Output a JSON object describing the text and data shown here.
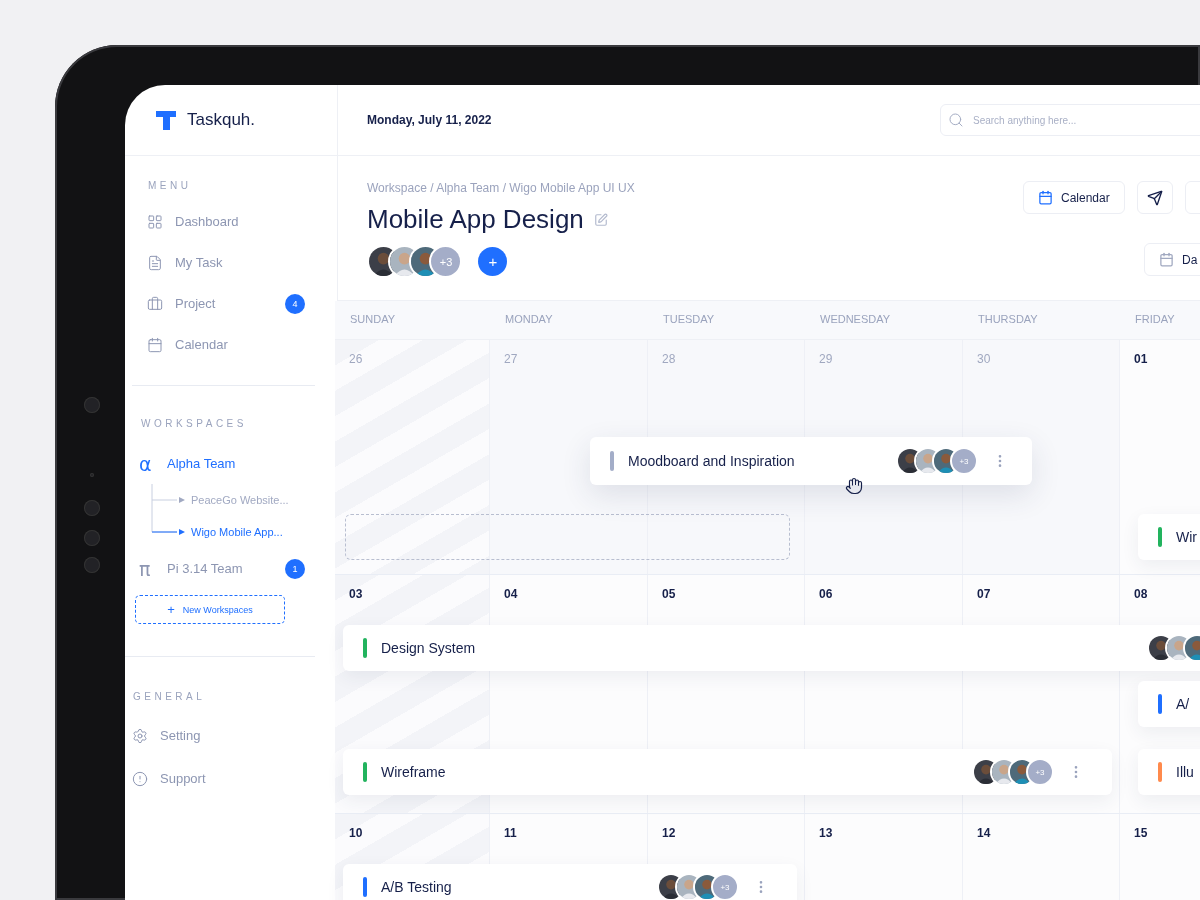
{
  "brand": {
    "name": "Taskquh."
  },
  "sidebar": {
    "menu": {
      "heading": "MENU",
      "items": [
        {
          "label": "Dashboard",
          "selected": false
        },
        {
          "label": "My Task",
          "selected": false
        },
        {
          "label": "Project",
          "selected": false,
          "badge": "4"
        },
        {
          "label": "Calendar",
          "selected": false
        }
      ]
    },
    "workspaces": {
      "heading": "WORKSPACES",
      "items": [
        {
          "symbol": "α",
          "label": "Alpha Team",
          "selected": true,
          "expanded": true,
          "children": [
            {
              "label": "PeaceGo Website...",
              "selected": false
            },
            {
              "label": "Wigo Mobile App...",
              "selected": true
            }
          ]
        },
        {
          "symbol": "π",
          "label": "Pi 3.14 Team",
          "selected": false,
          "badge": "1"
        }
      ],
      "new_button": {
        "icon": "+",
        "label": "New Workspaces"
      }
    },
    "general": {
      "heading": "GENERAL",
      "items": [
        {
          "label": "Setting",
          "selected": false
        },
        {
          "label": "Support",
          "selected": false
        }
      ]
    }
  },
  "topbar": {
    "date": "Monday, July 11, 2022",
    "search": {
      "placeholder": "Search anything here..."
    }
  },
  "header": {
    "breadcrumb": "Workspace / Alpha Team / Wigo Mobile App UI UX",
    "title": "Mobile App Design",
    "members": {
      "more": "+3"
    },
    "add_button": "+",
    "actions": [
      {
        "kind": "labeled",
        "label": "Calendar"
      },
      {
        "kind": "icon"
      },
      {
        "kind": "cut"
      }
    ],
    "view_button": {
      "label": "Da"
    }
  },
  "calendar": {
    "weekdays": [
      "SUNDAY",
      "MONDAY",
      "TUESDAY",
      "WEDNESDAY",
      "THURSDAY",
      "FRIDAY"
    ],
    "weeks": [
      {
        "days": [
          {
            "label": "26",
            "muted": true
          },
          {
            "label": "27",
            "muted": true
          },
          {
            "label": "28",
            "muted": true
          },
          {
            "label": "29",
            "muted": true
          },
          {
            "label": "30",
            "muted": true
          },
          {
            "label": "01",
            "muted": false
          }
        ],
        "dragging": {
          "title": "Moodboard and Inspiration",
          "color": "#a3adc8",
          "avatars": true,
          "more": "+3",
          "menu": true
        },
        "drop_placeholder": true,
        "events": [
          {
            "title": "Wir",
            "color": "#22b35e"
          }
        ]
      },
      {
        "days": [
          {
            "label": "03",
            "muted": false
          },
          {
            "label": "04",
            "muted": false
          },
          {
            "label": "05",
            "muted": false
          },
          {
            "label": "06",
            "muted": false
          },
          {
            "label": "07",
            "muted": false
          },
          {
            "label": "08",
            "muted": false
          }
        ],
        "events": [
          {
            "title": "Design System",
            "color": "#22b35e",
            "avatars": true
          },
          {
            "title": "A/",
            "color": "#1f6fff"
          },
          {
            "title": "Wireframe",
            "color": "#22b35e",
            "avatars": true,
            "more": "+3",
            "menu": true
          },
          {
            "title": "Illu",
            "color": "#ff8a4c"
          }
        ]
      },
      {
        "days": [
          {
            "label": "10",
            "muted": false
          },
          {
            "label": "11",
            "muted": false
          },
          {
            "label": "12",
            "muted": false
          },
          {
            "label": "13",
            "muted": false
          },
          {
            "label": "14",
            "muted": false
          },
          {
            "label": "15",
            "muted": false
          }
        ],
        "events": [
          {
            "title": "A/B Testing",
            "color": "#1f6fff",
            "avatars": true,
            "more": "+3",
            "menu": true
          }
        ]
      }
    ]
  }
}
